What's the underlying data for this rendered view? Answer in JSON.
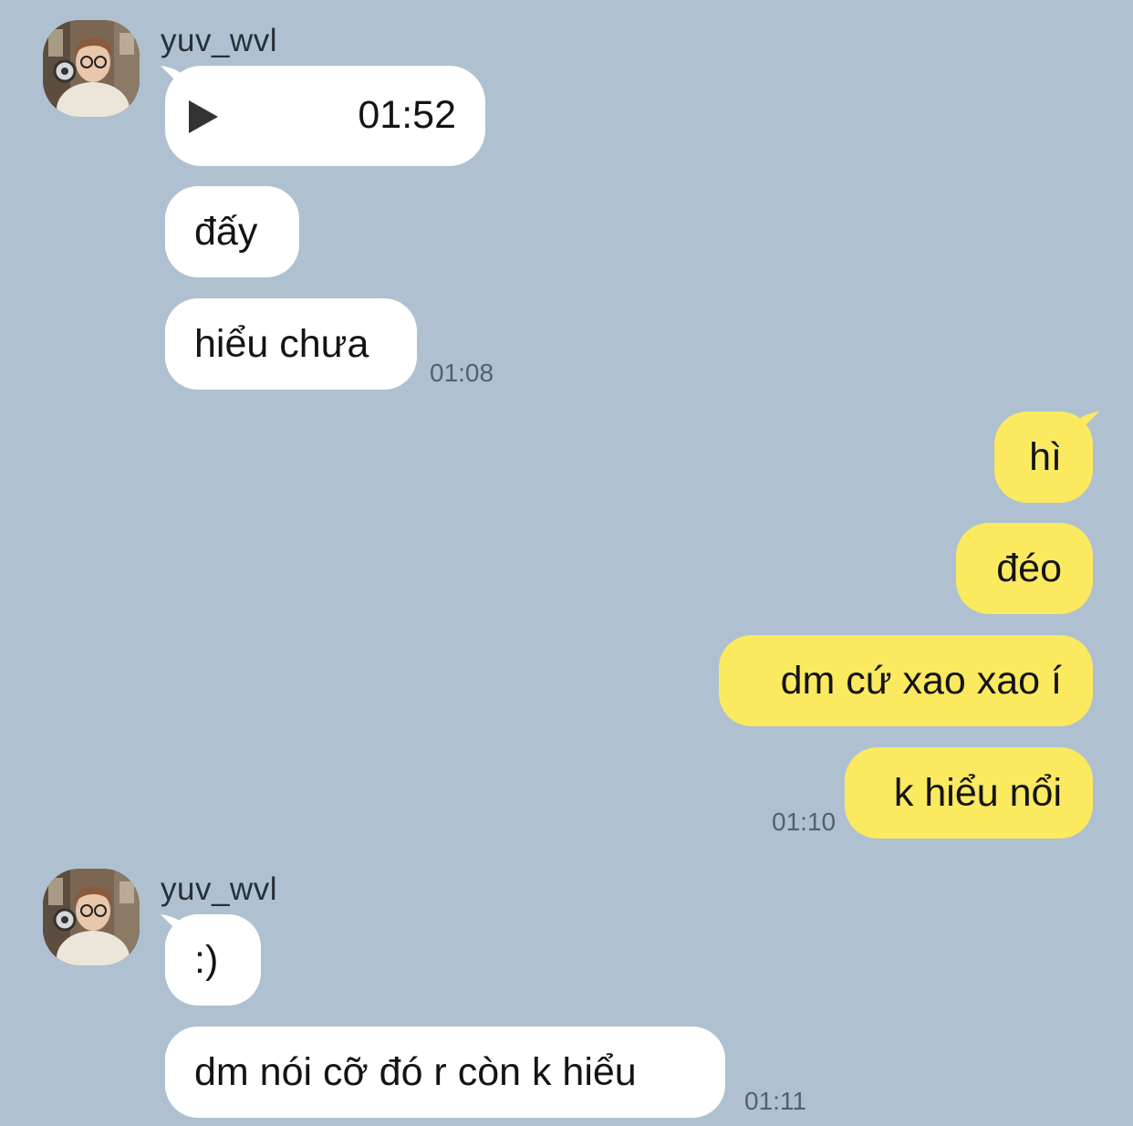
{
  "colors": {
    "background": "#afc1d1",
    "incoming_bubble": "#ffffff",
    "outgoing_bubble": "#fbe960",
    "timestamp": "#56606b"
  },
  "group1": {
    "sender": "yuv_wvl",
    "voice_message": {
      "icon": "play-icon",
      "duration": "01:52"
    },
    "messages": [
      "đấy",
      "hiểu chưa"
    ],
    "time": "01:08"
  },
  "group2": {
    "messages": [
      "hì",
      "đéo",
      "dm cứ xao xao í",
      "k hiểu nổi"
    ],
    "time": "01:10"
  },
  "group3": {
    "sender": "yuv_wvl",
    "messages": [
      ":)",
      "dm nói cỡ đó r còn k hiểu"
    ],
    "time": "01:11"
  }
}
